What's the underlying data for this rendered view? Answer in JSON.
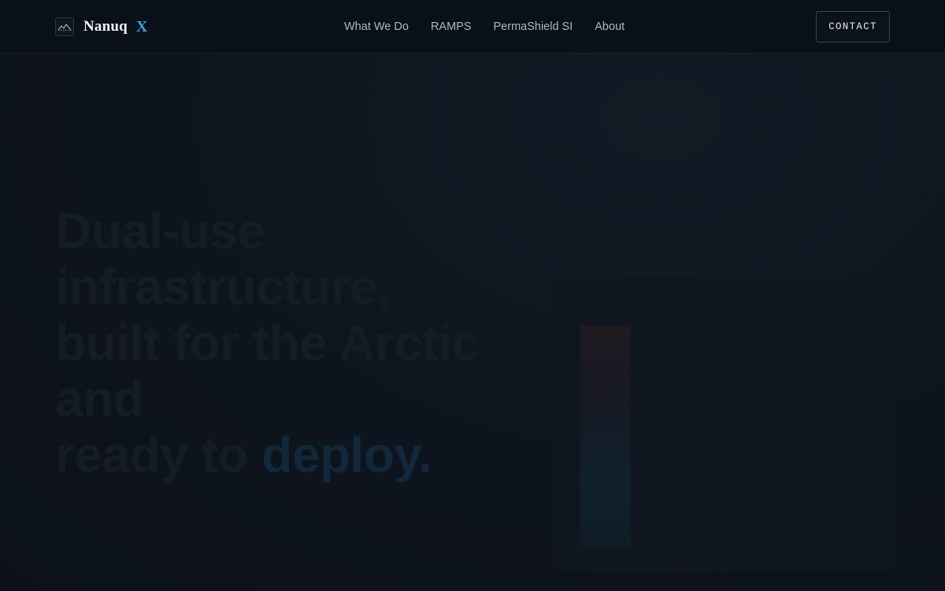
{
  "brand": {
    "name": "Nanuq",
    "mark": "X",
    "logo_icon": "mountain-chart-icon"
  },
  "nav": {
    "items": [
      {
        "label": "What We Do"
      },
      {
        "label": "RAMPS"
      },
      {
        "label": "PermaShield SI"
      },
      {
        "label": "About"
      }
    ]
  },
  "header": {
    "contact_label": "CONTACT"
  },
  "hero": {
    "title_lines": [
      "Dual-use",
      "infrastructure,",
      "built for the Arctic",
      "and"
    ],
    "title_last_prefix": "ready to ",
    "title_accent": "deploy."
  },
  "colors": {
    "accent": "#3d9ed8",
    "background": "#0d131c",
    "header_background": "#0a1017",
    "text_primary": "#f2f4f6",
    "nav_text": "#aeb7c2"
  }
}
